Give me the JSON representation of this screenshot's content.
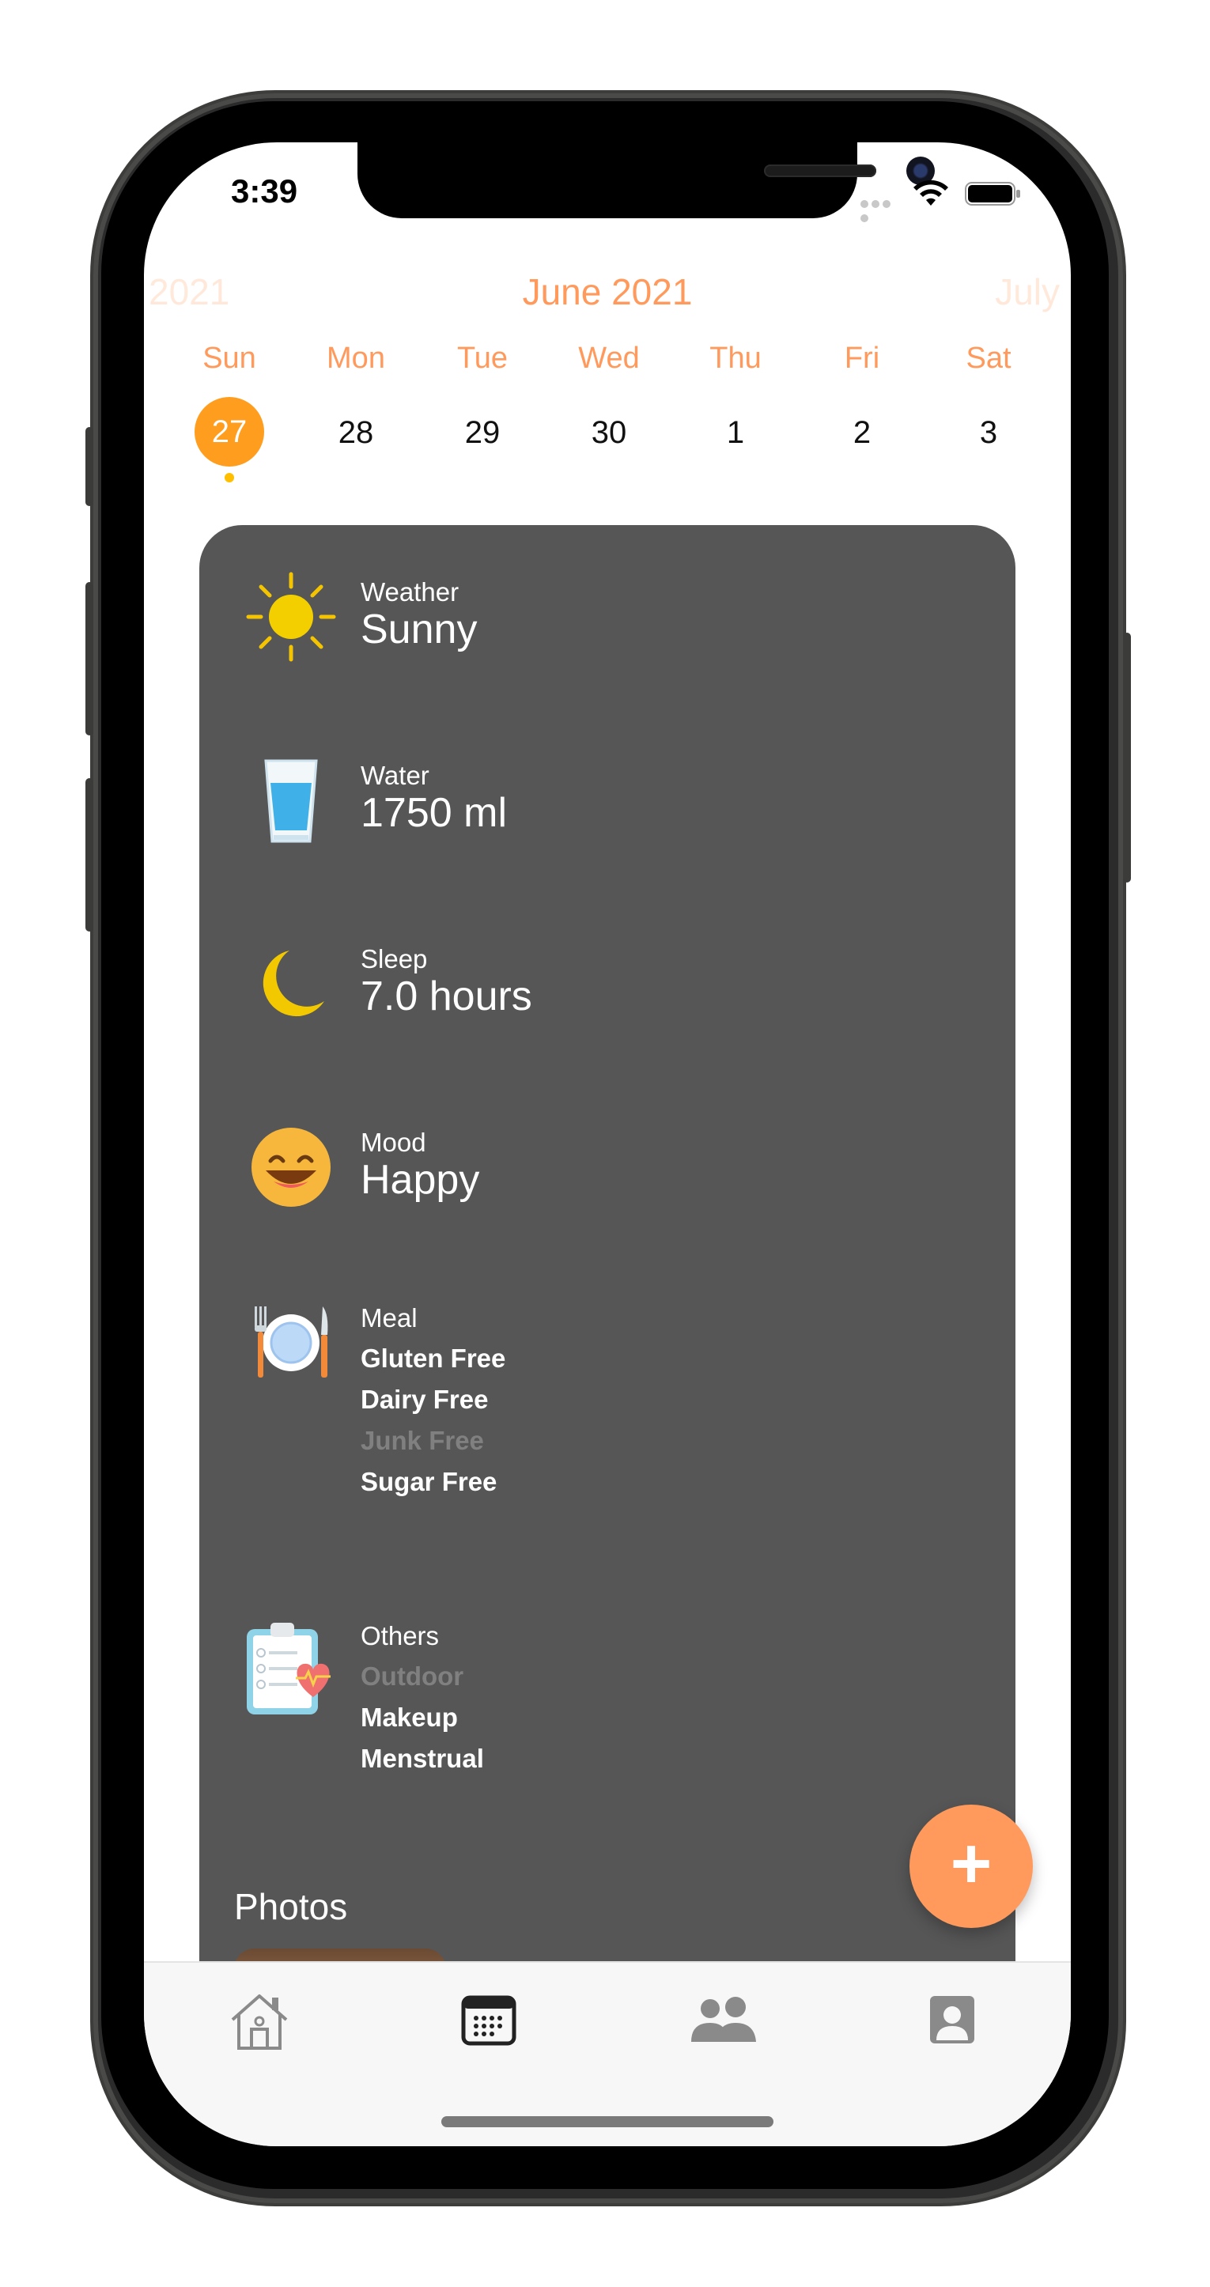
{
  "status_bar": {
    "time": "3:39"
  },
  "calendar": {
    "prev_month": "2021",
    "current_month": "June 2021",
    "next_month": "July",
    "weekdays": [
      "Sun",
      "Mon",
      "Tue",
      "Wed",
      "Thu",
      "Fri",
      "Sat"
    ],
    "dates": [
      "27",
      "28",
      "29",
      "30",
      "1",
      "2",
      "3"
    ],
    "selected_index": 0,
    "accent_color": "#ff9a5c",
    "selected_color": "#ff9d1e"
  },
  "entries": {
    "weather": {
      "label": "Weather",
      "value": "Sunny",
      "icon": "sun-icon"
    },
    "water": {
      "label": "Water",
      "value": "1750 ml",
      "icon": "water-glass-icon"
    },
    "sleep": {
      "label": "Sleep",
      "value": "7.0 hours",
      "icon": "moon-icon"
    },
    "mood": {
      "label": "Mood",
      "value": "Happy",
      "icon": "happy-face-icon"
    },
    "meal": {
      "label": "Meal",
      "icon": "plate-cutlery-icon",
      "items": [
        "Gluten Free",
        "Dairy Free",
        "Junk Free",
        "Sugar Free"
      ],
      "muted": [
        false,
        false,
        true,
        false
      ]
    },
    "others": {
      "label": "Others",
      "icon": "clipboard-heart-icon",
      "items": [
        "Outdoor",
        "Makeup",
        "Menstrual"
      ],
      "muted": [
        true,
        false,
        false
      ]
    }
  },
  "photos": {
    "title": "Photos"
  },
  "fab": {
    "label": "+"
  },
  "tabbar": {
    "items": [
      "home-icon",
      "calendar-icon",
      "people-icon",
      "profile-icon"
    ],
    "active_index": 1
  },
  "colors": {
    "card_bg": "#565656",
    "fab_bg": "#ff9a5c"
  }
}
